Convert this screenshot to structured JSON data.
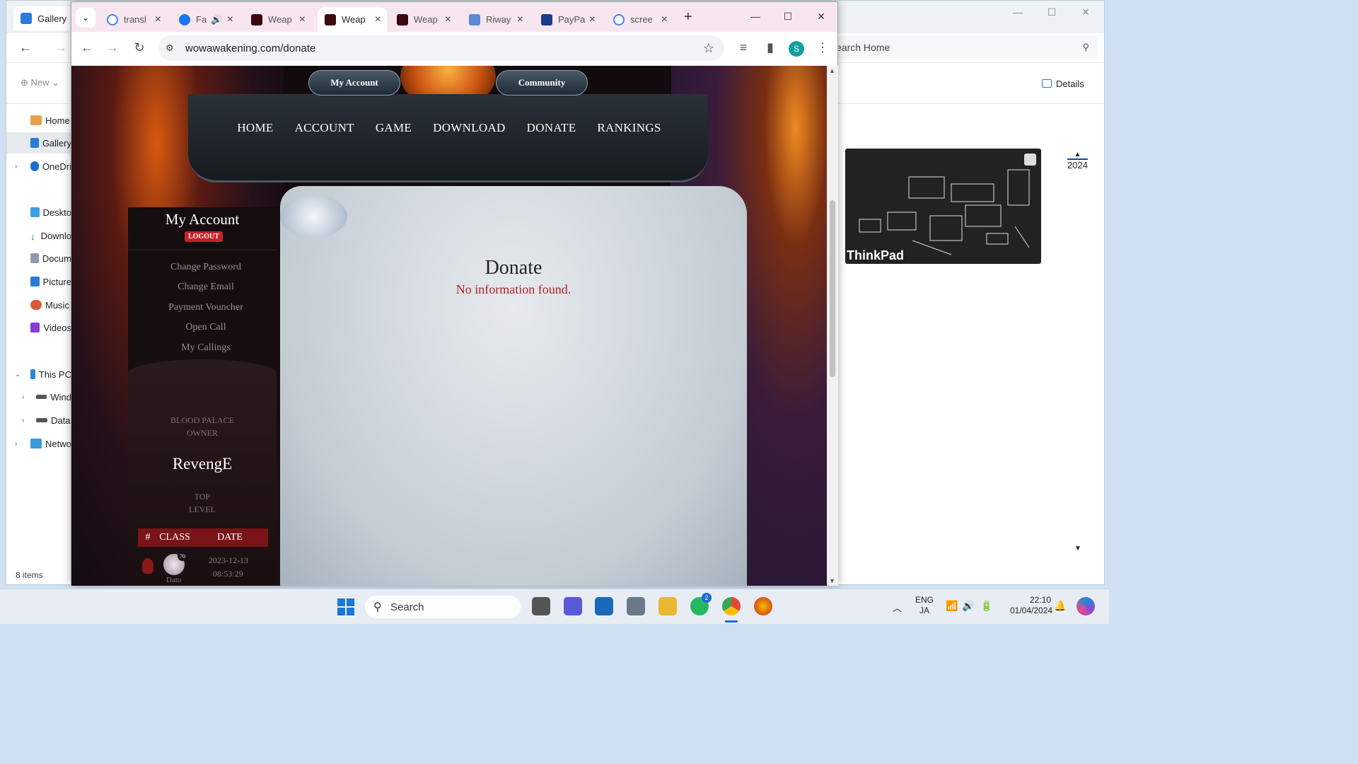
{
  "explorer": {
    "tab_title": "Gallery",
    "search_placeholder": "earch Home",
    "new_label": "New",
    "details_label": "Details",
    "nav": [
      "Home",
      "Gallery",
      "OneDri",
      "Deskto",
      "Downlo",
      "Docum",
      "Picture",
      "Music",
      "Videos",
      "This PC",
      "Wind",
      "Data",
      "Netwo"
    ],
    "status": "8 items",
    "year": "2024",
    "thumb_label": "ThinkPad"
  },
  "browser": {
    "tabs": [
      "transl",
      "Fa",
      "Weap",
      "Weap",
      "Weap",
      "Riway",
      "PayPa",
      "scree"
    ],
    "url": "wowawakening.com/donate",
    "profile_initial": "S"
  },
  "site": {
    "top_links": [
      "My Account",
      "Community"
    ],
    "nav": [
      "HOME",
      "ACCOUNT",
      "GAME",
      "DOWNLOAD",
      "DONATE",
      "RANKINGS"
    ],
    "sidebar": {
      "title": "My Account",
      "logout": "LOGOUT",
      "links": [
        "Change Password",
        "Change Email",
        "Payment Vouncher",
        "Open Call",
        "My Callings"
      ],
      "owner_label": "BLOOD PALACE\nOWNER",
      "owner_name": "RevengE",
      "top_label": "TOP\nLEVEL",
      "table_headers": [
        "#",
        "CLASS",
        "DATE"
      ],
      "row": {
        "level": "70",
        "name": "Dato",
        "date": "2023-12-13",
        "time": "08:53:29"
      }
    },
    "content": {
      "title": "Donate",
      "message": "No information found."
    }
  },
  "taskbar": {
    "search": "Search",
    "lang_1": "ENG",
    "lang_2": "JA",
    "time": "22:10",
    "date": "01/04/2024",
    "whatsapp_badge": "2"
  }
}
